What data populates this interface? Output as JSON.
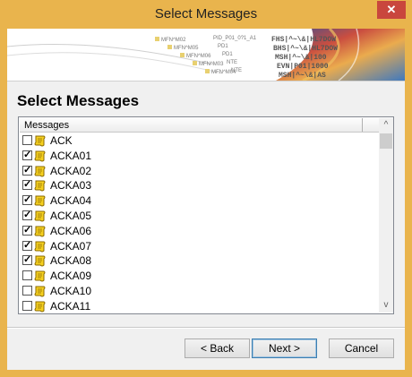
{
  "window": {
    "title": "Select Messages",
    "close_glyph": "✕"
  },
  "banner": {
    "tree_labels": [
      "MFN^M02",
      "MFN^M05",
      "MFN^M06",
      "MFN^M03",
      "MFN^M04"
    ],
    "tree_items": [
      "PID_P01_0?1_A1",
      "PD1",
      "PD1",
      "NTE",
      "NTE"
    ],
    "code_lines": [
      "FHS|^~\\&|HL7DOW",
      "BHS|^~\\&|HL7DOW",
      "MSH|^~\\&|100",
      "EVN|P01|1000",
      "MSH|^~\\&|AS"
    ]
  },
  "heading": "Select Messages",
  "list": {
    "column_header": "Messages",
    "items": [
      {
        "label": "ACK",
        "checked": false
      },
      {
        "label": "ACKA01",
        "checked": true
      },
      {
        "label": "ACKA02",
        "checked": true
      },
      {
        "label": "ACKA03",
        "checked": true
      },
      {
        "label": "ACKA04",
        "checked": true
      },
      {
        "label": "ACKA05",
        "checked": true
      },
      {
        "label": "ACKA06",
        "checked": true
      },
      {
        "label": "ACKA07",
        "checked": true
      },
      {
        "label": "ACKA08",
        "checked": true
      },
      {
        "label": "ACKA09",
        "checked": false
      },
      {
        "label": "ACKA10",
        "checked": false
      },
      {
        "label": "ACKA11",
        "checked": false
      }
    ],
    "scroll_up_glyph": "^",
    "scroll_down_glyph": "v"
  },
  "buttons": {
    "back": "< Back",
    "next": "Next >",
    "cancel": "Cancel"
  },
  "colors": {
    "titlebar": "#e9b44d",
    "close": "#c9463d",
    "default_border": "#3c7fb1"
  },
  "icons": {
    "message": "scroll-message-icon",
    "close": "close-icon"
  }
}
